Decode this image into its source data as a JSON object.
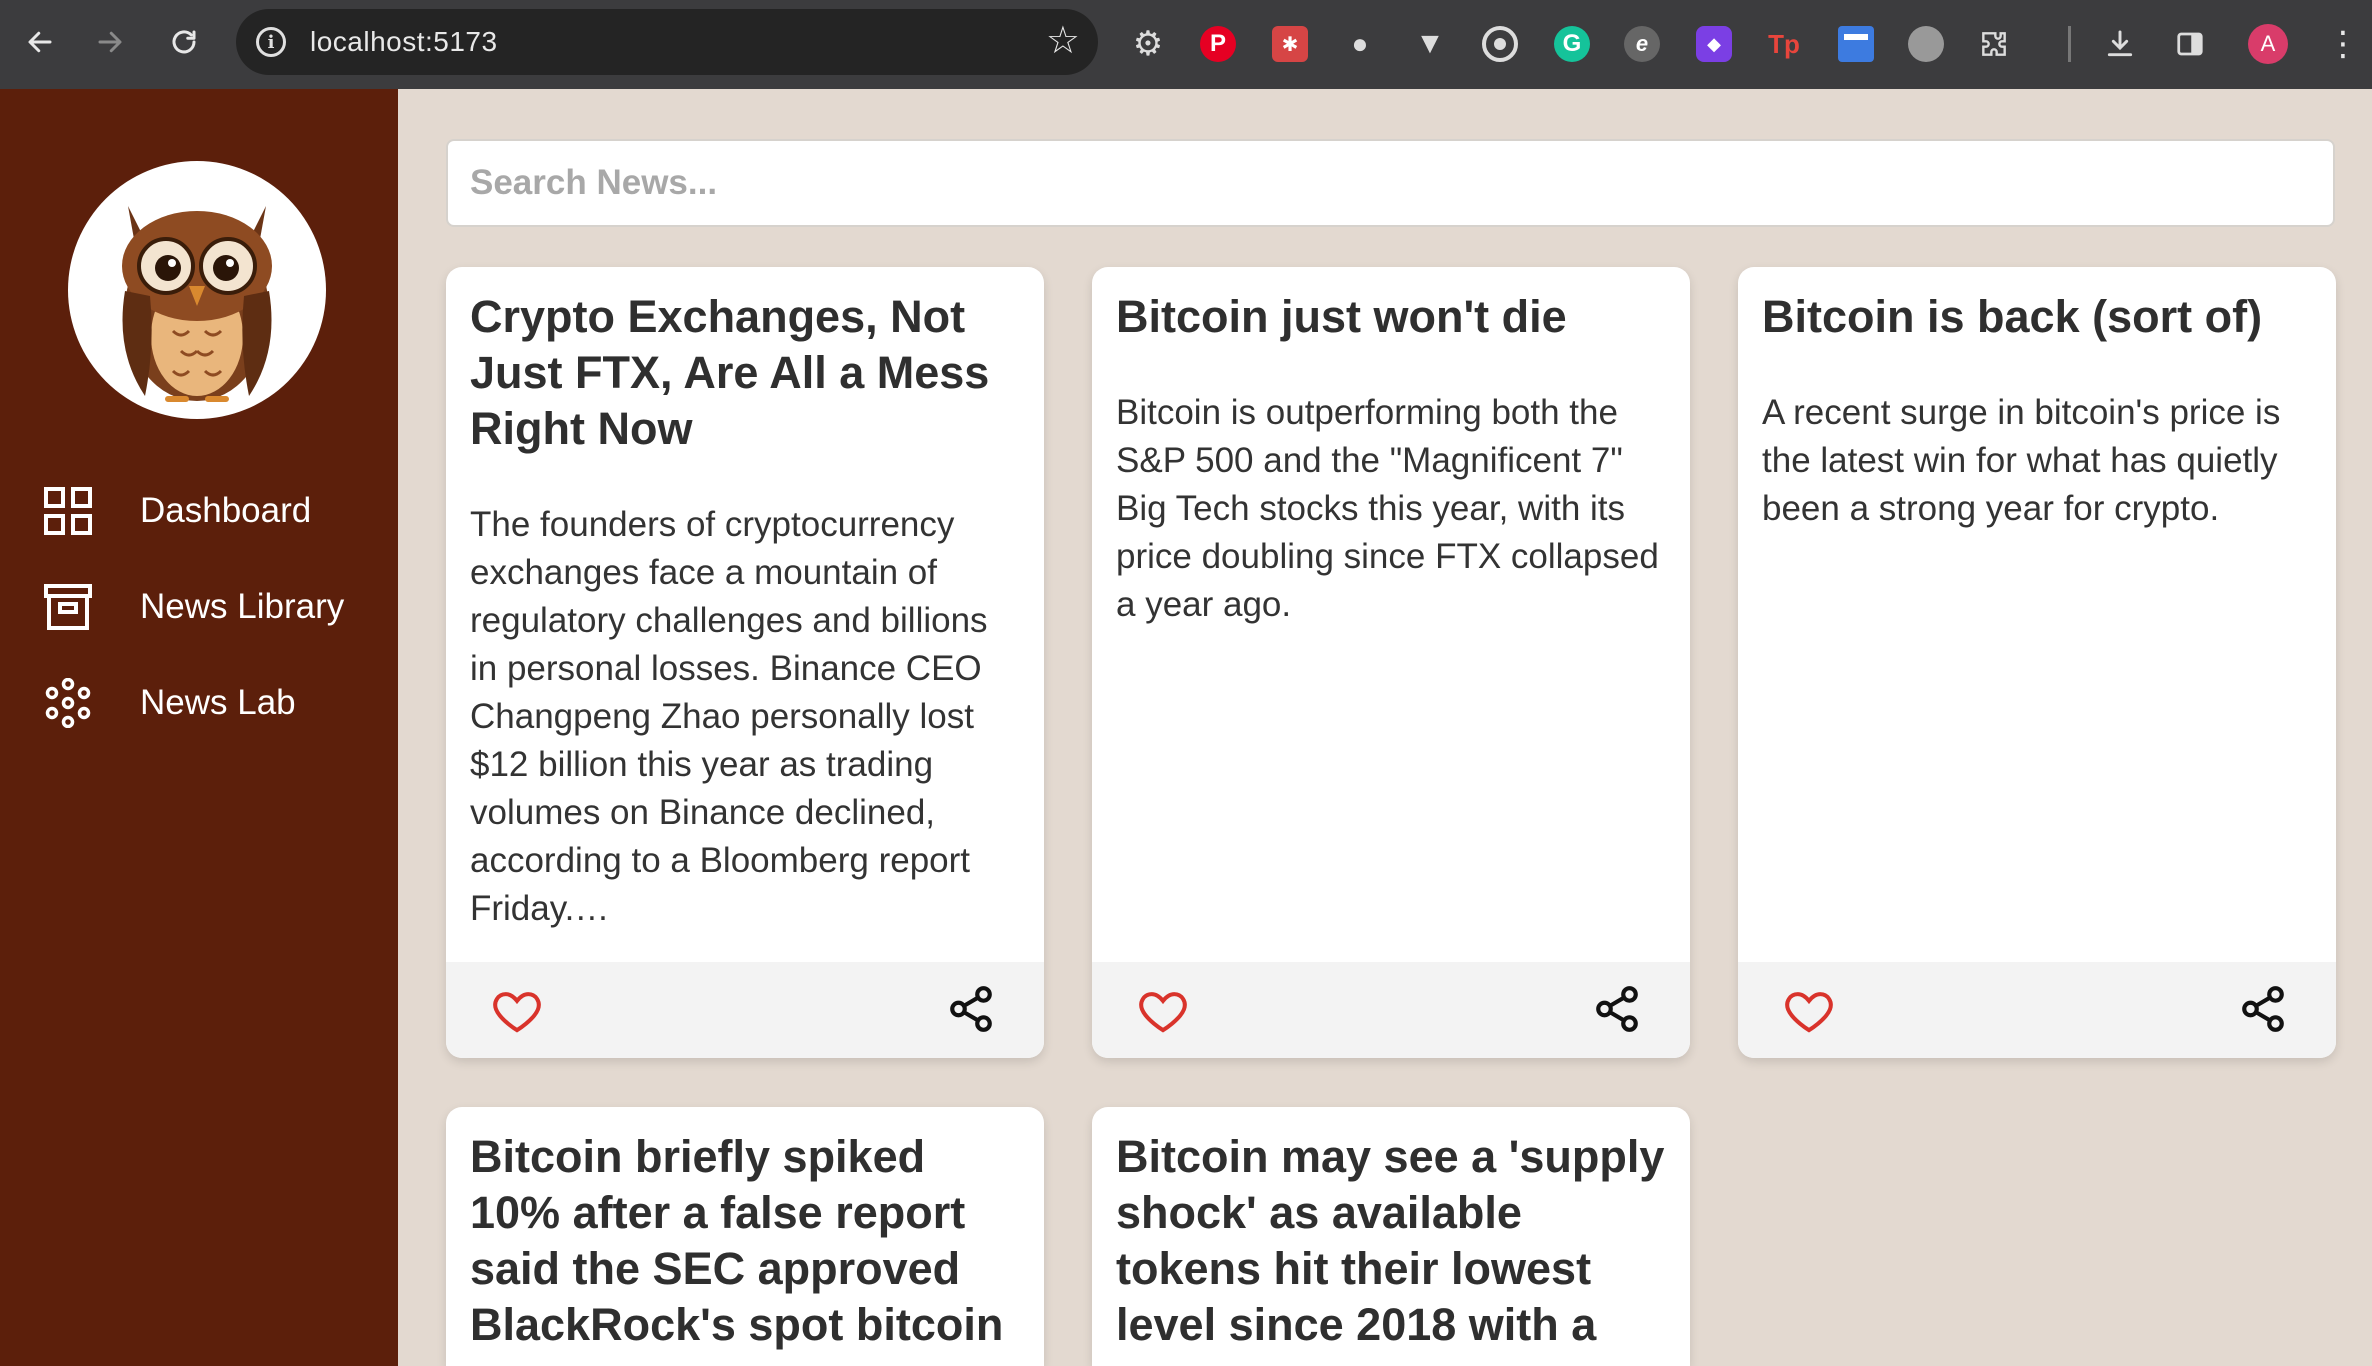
{
  "browser": {
    "url": "localhost:5173",
    "profile_initial": "A"
  },
  "sidebar": {
    "logo_name": "owl-logo",
    "items": [
      {
        "label": "Dashboard",
        "icon": "grid-icon"
      },
      {
        "label": "News Library",
        "icon": "archive-icon"
      },
      {
        "label": "News Lab",
        "icon": "dots-circle-icon"
      }
    ]
  },
  "search": {
    "placeholder": "Search News..."
  },
  "cards": [
    {
      "title": "Crypto Exchanges, Not Just FTX, Are All a Mess Right Now",
      "text": "The founders of cryptocurrency exchanges face a mountain of regulatory challenges and billions in personal losses. Binance CEO Changpeng Zhao personally lost $12 billion this year as trading volumes on Binance declined, according to a Bloomberg report Friday.…"
    },
    {
      "title": "Bitcoin just won't die",
      "text": "Bitcoin is outperforming both the S&P 500 and the \"Magnificent 7\" Big Tech stocks this year, with its price doubling since FTX collapsed a year ago."
    },
    {
      "title": "Bitcoin is back (sort of)",
      "text": "A recent surge in bitcoin's price is the latest win for what has quietly been a strong year for crypto."
    },
    {
      "title": "Bitcoin briefly spiked 10% after a false report said the SEC approved BlackRock's spot bitcoin",
      "text": ""
    },
    {
      "title": "Bitcoin may see a 'supply shock' as available tokens hit their lowest level since 2018 with a",
      "text": ""
    }
  ],
  "colors": {
    "sidebar": "#5c1f0b",
    "background": "#e3d9d0",
    "heart": "#d9332b"
  }
}
